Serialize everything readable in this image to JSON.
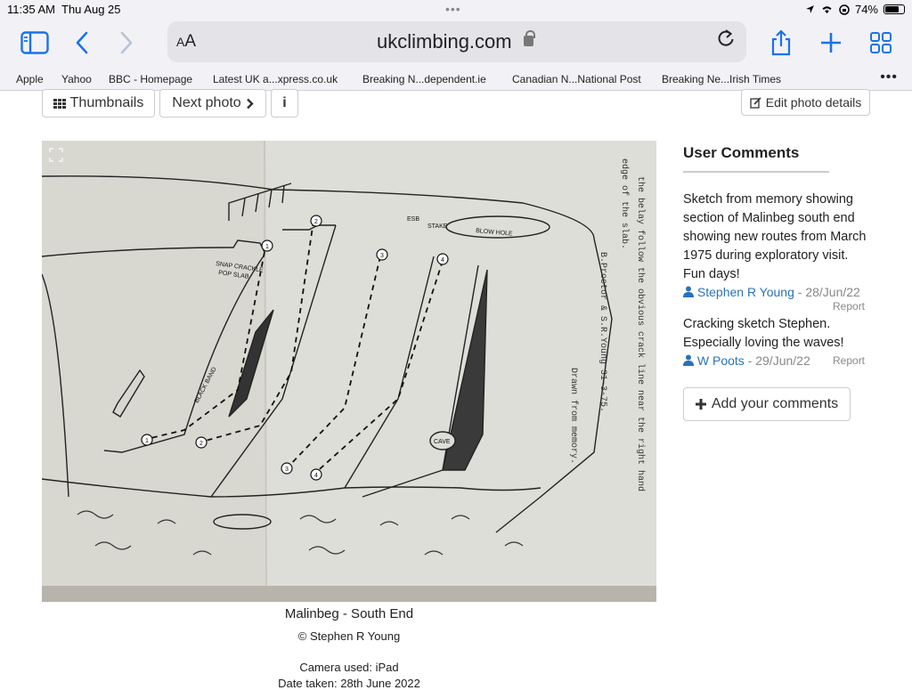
{
  "status_bar": {
    "time": "11:35 AM",
    "date": "Thu Aug 25",
    "battery": "74%",
    "battery_level": 0.74
  },
  "browser": {
    "url": "ukclimbing.com",
    "reader_label": "AA"
  },
  "bookmarks": [
    "Apple",
    "Yahoo",
    "BBC - Homepage",
    "Latest UK a...xpress.co.uk",
    "Breaking N...dependent.ie",
    "Canadian N...National Post",
    "Breaking Ne...Irish Times"
  ],
  "toolbar": {
    "thumbnails_label": "Thumbnails",
    "next_photo_label": "Next photo",
    "info_label": "i",
    "edit_label": "Edit photo details"
  },
  "photo": {
    "sketch_labels": {
      "snap": "SNAP CRACKLE",
      "pop": "POP SLAB",
      "black_band": "BLACK BAND",
      "blow_hole": "BLOW HOLE",
      "esb": "ESB",
      "stake": "STAKE",
      "cave": "CAVE",
      "n1": "1",
      "n2": "2",
      "n3": "3",
      "n4": "4"
    },
    "typed_note": {
      "line1": "the belay follow the obvious crack line near the right hand",
      "line2": "edge of the slab.",
      "line3": "B.Proctor & S.R.Young 31-3-75.",
      "line4": "Drawn from memory."
    }
  },
  "caption": {
    "title": "Malinbeg - South End",
    "copyright": "© Stephen R Young",
    "camera": "Camera used: iPad",
    "date_taken": "Date taken: 28th June 2022"
  },
  "comments": {
    "heading": "User Comments",
    "items": [
      {
        "text": "Sketch from memory showing section of Malinbeg south end showing new routes from March 1975 during exploratory visit. Fun days!",
        "user": "Stephen R Young",
        "date": " - 28/Jun/22",
        "report": "Report"
      },
      {
        "text": "Cracking sketch Stephen. Especially loving the waves!",
        "user": "W Poots",
        "date": " - 29/Jun/22",
        "report": "Report"
      }
    ],
    "add_label": "Add your comments"
  }
}
